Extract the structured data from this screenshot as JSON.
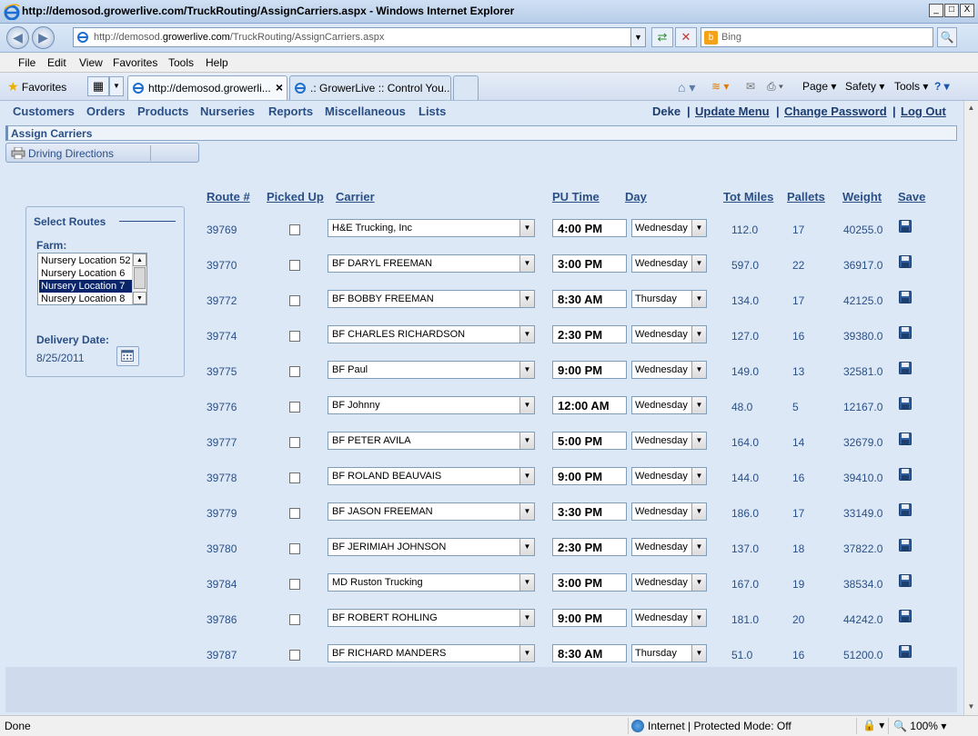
{
  "window": {
    "title": "http://demosod.growerlive.com/TruckRouting/AssignCarriers.aspx - Windows Internet Explorer",
    "minimize": "_",
    "maximize": "□",
    "close": "X"
  },
  "address": {
    "url_prefix": "http://demosod.",
    "url_domain": "growerlive.com",
    "url_path": "/TruckRouting/AssignCarriers.aspx",
    "search_placeholder": "Bing"
  },
  "menu": [
    "File",
    "Edit",
    "View",
    "Favorites",
    "Tools",
    "Help"
  ],
  "favorites_label": "Favorites",
  "tabs": [
    {
      "label": "http://demosod.growerli...",
      "active": true
    },
    {
      "label": ".: GrowerLive :: Control You...",
      "active": false
    }
  ],
  "commandbar": {
    "page": "Page",
    "safety": "Safety",
    "tools": "Tools"
  },
  "nav": {
    "links": [
      "Customers",
      "Orders",
      "Products",
      "Nurseries",
      "Reports",
      "Miscellaneous",
      "Lists"
    ],
    "user": "Deke",
    "update_menu": "Update Menu",
    "change_password": "Change Password",
    "logout": "Log Out",
    "sep": "|"
  },
  "section_title": "Assign Carriers",
  "driving_directions": "Driving Directions",
  "routes_panel": {
    "legend": "Select Routes",
    "farm_label": "Farm:",
    "farm_options": [
      "Nursery Location 52",
      "Nursery Location 6",
      "Nursery Location 7",
      "Nursery Location 8"
    ],
    "selected_index": 2,
    "delivery_label": "Delivery Date:",
    "delivery_date": "8/25/2011"
  },
  "table": {
    "headers": {
      "route": "Route #",
      "picked_up": "Picked Up",
      "carrier": "Carrier",
      "pu_time": "PU Time",
      "day": "Day",
      "miles": "Tot Miles",
      "pallets": "Pallets",
      "weight": "Weight",
      "save": "Save"
    },
    "rows": [
      {
        "route": "39769",
        "carrier": "H&E Trucking, Inc",
        "time": "4:00 PM",
        "day": "Wednesday",
        "miles": "112.0",
        "pallets": "17",
        "weight": "40255.0"
      },
      {
        "route": "39770",
        "carrier": "BF DARYL FREEMAN",
        "time": "3:00 PM",
        "day": "Wednesday",
        "miles": "597.0",
        "pallets": "22",
        "weight": "36917.0"
      },
      {
        "route": "39772",
        "carrier": "BF BOBBY FREEMAN",
        "time": "8:30 AM",
        "day": "Thursday",
        "miles": "134.0",
        "pallets": "17",
        "weight": "42125.0"
      },
      {
        "route": "39774",
        "carrier": "BF CHARLES RICHARDSON",
        "time": "2:30 PM",
        "day": "Wednesday",
        "miles": "127.0",
        "pallets": "16",
        "weight": "39380.0"
      },
      {
        "route": "39775",
        "carrier": "BF Paul",
        "time": "9:00 PM",
        "day": "Wednesday",
        "miles": "149.0",
        "pallets": "13",
        "weight": "32581.0"
      },
      {
        "route": "39776",
        "carrier": "BF Johnny",
        "time": "12:00 AM",
        "day": "Wednesday",
        "miles": "48.0",
        "pallets": "5",
        "weight": "12167.0"
      },
      {
        "route": "39777",
        "carrier": "BF PETER AVILA",
        "time": "5:00 PM",
        "day": "Wednesday",
        "miles": "164.0",
        "pallets": "14",
        "weight": "32679.0"
      },
      {
        "route": "39778",
        "carrier": "BF ROLAND BEAUVAIS",
        "time": "9:00 PM",
        "day": "Wednesday",
        "miles": "144.0",
        "pallets": "16",
        "weight": "39410.0"
      },
      {
        "route": "39779",
        "carrier": "BF JASON FREEMAN",
        "time": "3:30 PM",
        "day": "Wednesday",
        "miles": "186.0",
        "pallets": "17",
        "weight": "33149.0"
      },
      {
        "route": "39780",
        "carrier": "BF JERIMIAH JOHNSON",
        "time": "2:30 PM",
        "day": "Wednesday",
        "miles": "137.0",
        "pallets": "18",
        "weight": "37822.0"
      },
      {
        "route": "39784",
        "carrier": "MD Ruston Trucking",
        "time": "3:00 PM",
        "day": "Wednesday",
        "miles": "167.0",
        "pallets": "19",
        "weight": "38534.0"
      },
      {
        "route": "39786",
        "carrier": "BF ROBERT ROHLING",
        "time": "9:00 PM",
        "day": "Wednesday",
        "miles": "181.0",
        "pallets": "20",
        "weight": "44242.0"
      },
      {
        "route": "39787",
        "carrier": "BF RICHARD MANDERS",
        "time": "8:30 AM",
        "day": "Thursday",
        "miles": "51.0",
        "pallets": "16",
        "weight": "51200.0"
      }
    ]
  },
  "status": {
    "left": "Done",
    "zone": "Internet | Protected Mode: Off",
    "zoom": "100%"
  }
}
